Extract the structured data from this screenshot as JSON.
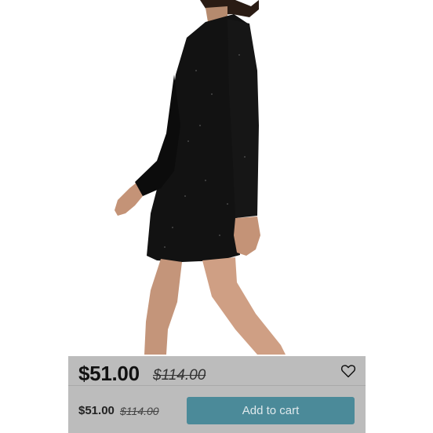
{
  "product": {
    "image_alt": "black sparkle velvet long-sleeve mini dress"
  },
  "price_bar": {
    "price_now": "$51.00",
    "price_was": "$114.00",
    "wishlist_icon": "heart-outline-icon"
  },
  "cart_bar": {
    "price_now": "$51.00",
    "price_was": "$114.00",
    "add_to_cart_label": "Add to cart",
    "button_color": "#4b8a99"
  }
}
